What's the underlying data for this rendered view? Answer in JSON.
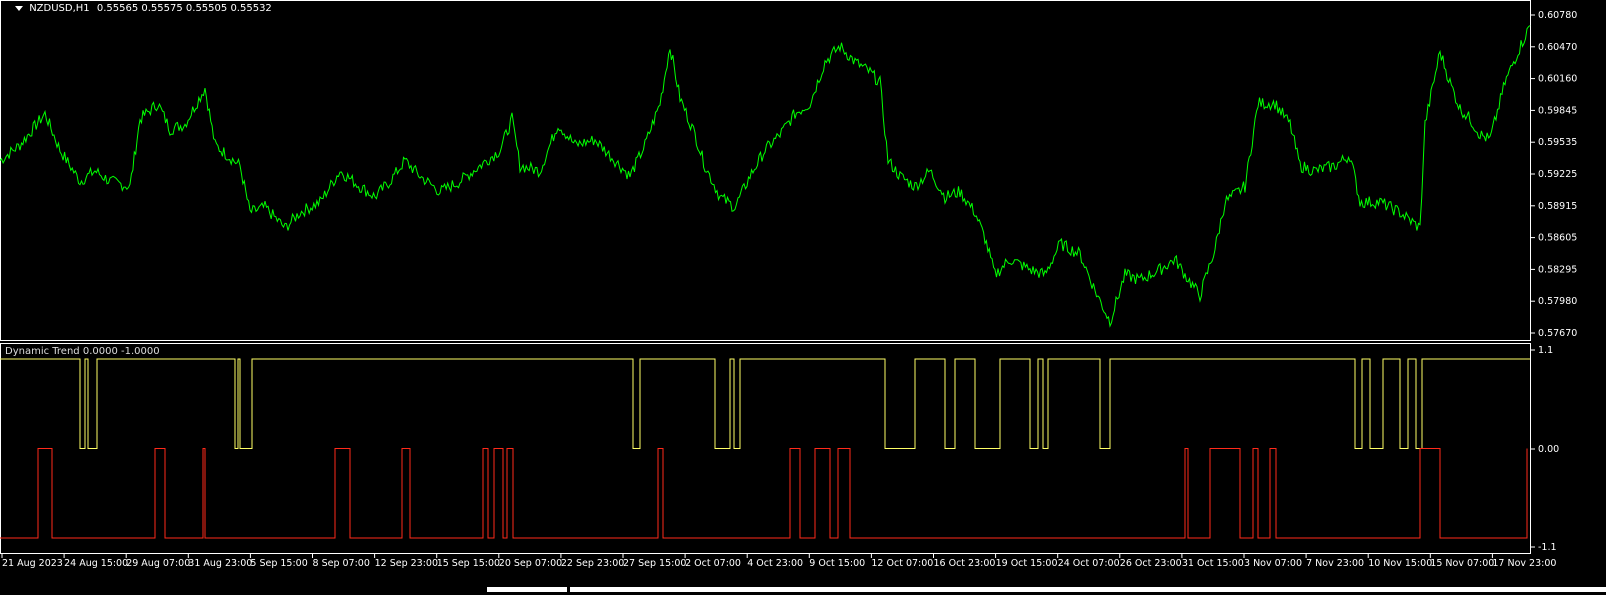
{
  "header": {
    "symbol": "NZDUSD,H1",
    "ohlc": "0.55565 0.55575 0.55505 0.55532"
  },
  "indicator": {
    "title": "Dynamic Trend 0.0000 -1.0000"
  },
  "colors": {
    "background": "#000000",
    "price_line": "#00ff00",
    "trend_up_line": "#ffff66",
    "trend_down_line": "#ff2a1a",
    "frame": "#ffffff"
  },
  "price_axis": {
    "labels": [
      "0.60780",
      "0.60470",
      "0.60160",
      "0.59845",
      "0.59535",
      "0.59225",
      "0.58915",
      "0.58605",
      "0.58295",
      "0.57980",
      "0.57670"
    ]
  },
  "indicator_axis": {
    "labels": [
      "1.1",
      "0.00",
      "-1.1"
    ]
  },
  "time_axis": {
    "labels": [
      "21 Aug 2023",
      "24 Aug 15:00",
      "29 Aug 07:00",
      "31 Aug 23:00",
      "5 Sep 15:00",
      "8 Sep 07:00",
      "12 Sep 23:00",
      "15 Sep 15:00",
      "20 Sep 07:00",
      "22 Sep 23:00",
      "27 Sep 15:00",
      "2 Oct 07:00",
      "4 Oct 23:00",
      "9 Oct 15:00",
      "12 Oct 07:00",
      "16 Oct 23:00",
      "19 Oct 15:00",
      "24 Oct 07:00",
      "26 Oct 23:00",
      "31 Oct 15:00",
      "3 Nov 07:00",
      "7 Nov 23:00",
      "10 Nov 15:00",
      "15 Nov 07:00",
      "17 Nov 23:00"
    ]
  },
  "chart_data": {
    "type": "line",
    "price_series": {
      "name": "NZDUSD,H1",
      "ylim": [
        0.5767,
        0.6078
      ],
      "points": [
        [
          0,
          0.5935
        ],
        [
          20,
          0.595
        ],
        [
          45,
          0.598
        ],
        [
          60,
          0.5945
        ],
        [
          80,
          0.5915
        ],
        [
          95,
          0.5925
        ],
        [
          110,
          0.5915
        ],
        [
          130,
          0.591
        ],
        [
          140,
          0.5975
        ],
        [
          158,
          0.599
        ],
        [
          170,
          0.5965
        ],
        [
          185,
          0.597
        ],
        [
          205,
          0.6005
        ],
        [
          215,
          0.595
        ],
        [
          240,
          0.593
        ],
        [
          250,
          0.5885
        ],
        [
          265,
          0.589
        ],
        [
          285,
          0.587
        ],
        [
          300,
          0.5885
        ],
        [
          320,
          0.5895
        ],
        [
          340,
          0.5925
        ],
        [
          360,
          0.591
        ],
        [
          375,
          0.59
        ],
        [
          390,
          0.5915
        ],
        [
          405,
          0.5935
        ],
        [
          420,
          0.592
        ],
        [
          440,
          0.5905
        ],
        [
          460,
          0.5915
        ],
        [
          480,
          0.593
        ],
        [
          500,
          0.5945
        ],
        [
          512,
          0.5975
        ],
        [
          520,
          0.593
        ],
        [
          540,
          0.5925
        ],
        [
          558,
          0.597
        ],
        [
          575,
          0.595
        ],
        [
          595,
          0.5955
        ],
        [
          615,
          0.5935
        ],
        [
          630,
          0.592
        ],
        [
          645,
          0.595
        ],
        [
          660,
          0.599
        ],
        [
          670,
          0.6045
        ],
        [
          680,
          0.5995
        ],
        [
          695,
          0.596
        ],
        [
          705,
          0.593
        ],
        [
          720,
          0.59
        ],
        [
          735,
          0.589
        ],
        [
          750,
          0.592
        ],
        [
          765,
          0.5945
        ],
        [
          780,
          0.596
        ],
        [
          795,
          0.598
        ],
        [
          810,
          0.599
        ],
        [
          825,
          0.603
        ],
        [
          840,
          0.6045
        ],
        [
          855,
          0.603
        ],
        [
          870,
          0.602
        ],
        [
          880,
          0.601
        ],
        [
          888,
          0.5935
        ],
        [
          900,
          0.592
        ],
        [
          915,
          0.591
        ],
        [
          930,
          0.5925
        ],
        [
          945,
          0.59
        ],
        [
          960,
          0.5905
        ],
        [
          975,
          0.5885
        ],
        [
          985,
          0.586
        ],
        [
          995,
          0.5825
        ],
        [
          1010,
          0.584
        ],
        [
          1030,
          0.583
        ],
        [
          1045,
          0.5825
        ],
        [
          1060,
          0.5855
        ],
        [
          1080,
          0.5845
        ],
        [
          1095,
          0.581
        ],
        [
          1110,
          0.578
        ],
        [
          1125,
          0.5825
        ],
        [
          1140,
          0.582
        ],
        [
          1160,
          0.583
        ],
        [
          1175,
          0.584
        ],
        [
          1185,
          0.5825
        ],
        [
          1200,
          0.5805
        ],
        [
          1215,
          0.585
        ],
        [
          1225,
          0.5895
        ],
        [
          1245,
          0.591
        ],
        [
          1258,
          0.599
        ],
        [
          1275,
          0.599
        ],
        [
          1290,
          0.597
        ],
        [
          1300,
          0.593
        ],
        [
          1315,
          0.5925
        ],
        [
          1335,
          0.593
        ],
        [
          1350,
          0.594
        ],
        [
          1360,
          0.5895
        ],
        [
          1380,
          0.5895
        ],
        [
          1400,
          0.5885
        ],
        [
          1420,
          0.587
        ],
        [
          1425,
          0.597
        ],
        [
          1440,
          0.604
        ],
        [
          1450,
          0.601
        ],
        [
          1460,
          0.5985
        ],
        [
          1470,
          0.5975
        ],
        [
          1480,
          0.596
        ],
        [
          1490,
          0.5955
        ],
        [
          1505,
          0.601
        ],
        [
          1518,
          0.604
        ],
        [
          1530,
          0.6065
        ]
      ]
    },
    "trend_up_series": {
      "name": "Dynamic Trend",
      "ylim": [
        -1.1,
        1.1
      ],
      "points": [
        [
          0,
          1.0
        ],
        [
          80,
          1.0
        ],
        [
          80,
          0.0
        ],
        [
          85,
          0.0
        ],
        [
          85,
          1.0
        ],
        [
          88,
          1.0
        ],
        [
          88,
          0.0
        ],
        [
          97,
          0.0
        ],
        [
          97,
          1.0
        ],
        [
          235,
          1.0
        ],
        [
          235,
          0.0
        ],
        [
          238,
          0.0
        ],
        [
          238,
          1.0
        ],
        [
          240,
          1.0
        ],
        [
          240,
          0.0
        ],
        [
          252,
          0.0
        ],
        [
          252,
          1.0
        ],
        [
          633,
          1.0
        ],
        [
          633,
          0.0
        ],
        [
          640,
          0.0
        ],
        [
          640,
          1.0
        ],
        [
          715,
          1.0
        ],
        [
          715,
          0.0
        ],
        [
          730,
          0.0
        ],
        [
          730,
          1.0
        ],
        [
          734,
          1.0
        ],
        [
          734,
          0.0
        ],
        [
          740,
          0.0
        ],
        [
          740,
          1.0
        ],
        [
          885,
          1.0
        ],
        [
          885,
          0.0
        ],
        [
          915,
          0.0
        ],
        [
          915,
          1.0
        ],
        [
          945,
          1.0
        ],
        [
          945,
          0.0
        ],
        [
          955,
          0.0
        ],
        [
          955,
          1.0
        ],
        [
          975,
          1.0
        ],
        [
          975,
          0.0
        ],
        [
          1000,
          0.0
        ],
        [
          1000,
          1.0
        ],
        [
          1030,
          1.0
        ],
        [
          1030,
          0.0
        ],
        [
          1038,
          0.0
        ],
        [
          1038,
          1.0
        ],
        [
          1043,
          1.0
        ],
        [
          1043,
          0.0
        ],
        [
          1048,
          0.0
        ],
        [
          1048,
          1.0
        ],
        [
          1100,
          1.0
        ],
        [
          1100,
          0.0
        ],
        [
          1110,
          0.0
        ],
        [
          1110,
          1.0
        ],
        [
          1355,
          1.0
        ],
        [
          1355,
          0.0
        ],
        [
          1362,
          0.0
        ],
        [
          1362,
          1.0
        ],
        [
          1370,
          1.0
        ],
        [
          1370,
          0.0
        ],
        [
          1383,
          0.0
        ],
        [
          1383,
          1.0
        ],
        [
          1400,
          1.0
        ],
        [
          1400,
          0.0
        ],
        [
          1408,
          0.0
        ],
        [
          1408,
          1.0
        ],
        [
          1416,
          1.0
        ],
        [
          1416,
          0.0
        ],
        [
          1422,
          0.0
        ],
        [
          1422,
          1.0
        ],
        [
          1530,
          1.0
        ]
      ]
    },
    "trend_down_series": {
      "name": "Dynamic Trend",
      "ylim": [
        -1.1,
        1.1
      ],
      "points": [
        [
          0,
          -1.0
        ],
        [
          38,
          -1.0
        ],
        [
          38,
          0.0
        ],
        [
          52,
          0.0
        ],
        [
          52,
          -1.0
        ],
        [
          155,
          -1.0
        ],
        [
          155,
          0.0
        ],
        [
          165,
          0.0
        ],
        [
          165,
          -1.0
        ],
        [
          203,
          -1.0
        ],
        [
          203,
          0.0
        ],
        [
          205,
          0.0
        ],
        [
          205,
          -1.0
        ],
        [
          335,
          -1.0
        ],
        [
          335,
          0.0
        ],
        [
          350,
          0.0
        ],
        [
          350,
          -1.0
        ],
        [
          402,
          -1.0
        ],
        [
          402,
          0.0
        ],
        [
          410,
          0.0
        ],
        [
          410,
          -1.0
        ],
        [
          483,
          -1.0
        ],
        [
          483,
          0.0
        ],
        [
          488,
          0.0
        ],
        [
          488,
          -1.0
        ],
        [
          494,
          -1.0
        ],
        [
          494,
          0.0
        ],
        [
          503,
          0.0
        ],
        [
          503,
          -1.0
        ],
        [
          507,
          -1.0
        ],
        [
          507,
          0.0
        ],
        [
          513,
          0.0
        ],
        [
          513,
          -1.0
        ],
        [
          658,
          -1.0
        ],
        [
          658,
          0.0
        ],
        [
          663,
          0.0
        ],
        [
          663,
          -1.0
        ],
        [
          790,
          -1.0
        ],
        [
          790,
          0.0
        ],
        [
          800,
          0.0
        ],
        [
          800,
          -1.0
        ],
        [
          815,
          -1.0
        ],
        [
          815,
          0.0
        ],
        [
          830,
          0.0
        ],
        [
          830,
          -1.0
        ],
        [
          838,
          -1.0
        ],
        [
          838,
          0.0
        ],
        [
          850,
          0.0
        ],
        [
          850,
          -1.0
        ],
        [
          1185,
          -1.0
        ],
        [
          1185,
          0.0
        ],
        [
          1188,
          0.0
        ],
        [
          1188,
          -1.0
        ],
        [
          1210,
          -1.0
        ],
        [
          1210,
          0.0
        ],
        [
          1240,
          0.0
        ],
        [
          1240,
          -1.0
        ],
        [
          1253,
          -1.0
        ],
        [
          1253,
          0.0
        ],
        [
          1258,
          0.0
        ],
        [
          1258,
          -1.0
        ],
        [
          1270,
          -1.0
        ],
        [
          1270,
          0.0
        ],
        [
          1276,
          0.0
        ],
        [
          1276,
          -1.0
        ],
        [
          1420,
          -1.0
        ],
        [
          1420,
          0.0
        ],
        [
          1440,
          0.0
        ],
        [
          1440,
          -1.0
        ],
        [
          1527,
          -1.0
        ],
        [
          1527,
          0.0
        ]
      ]
    }
  }
}
